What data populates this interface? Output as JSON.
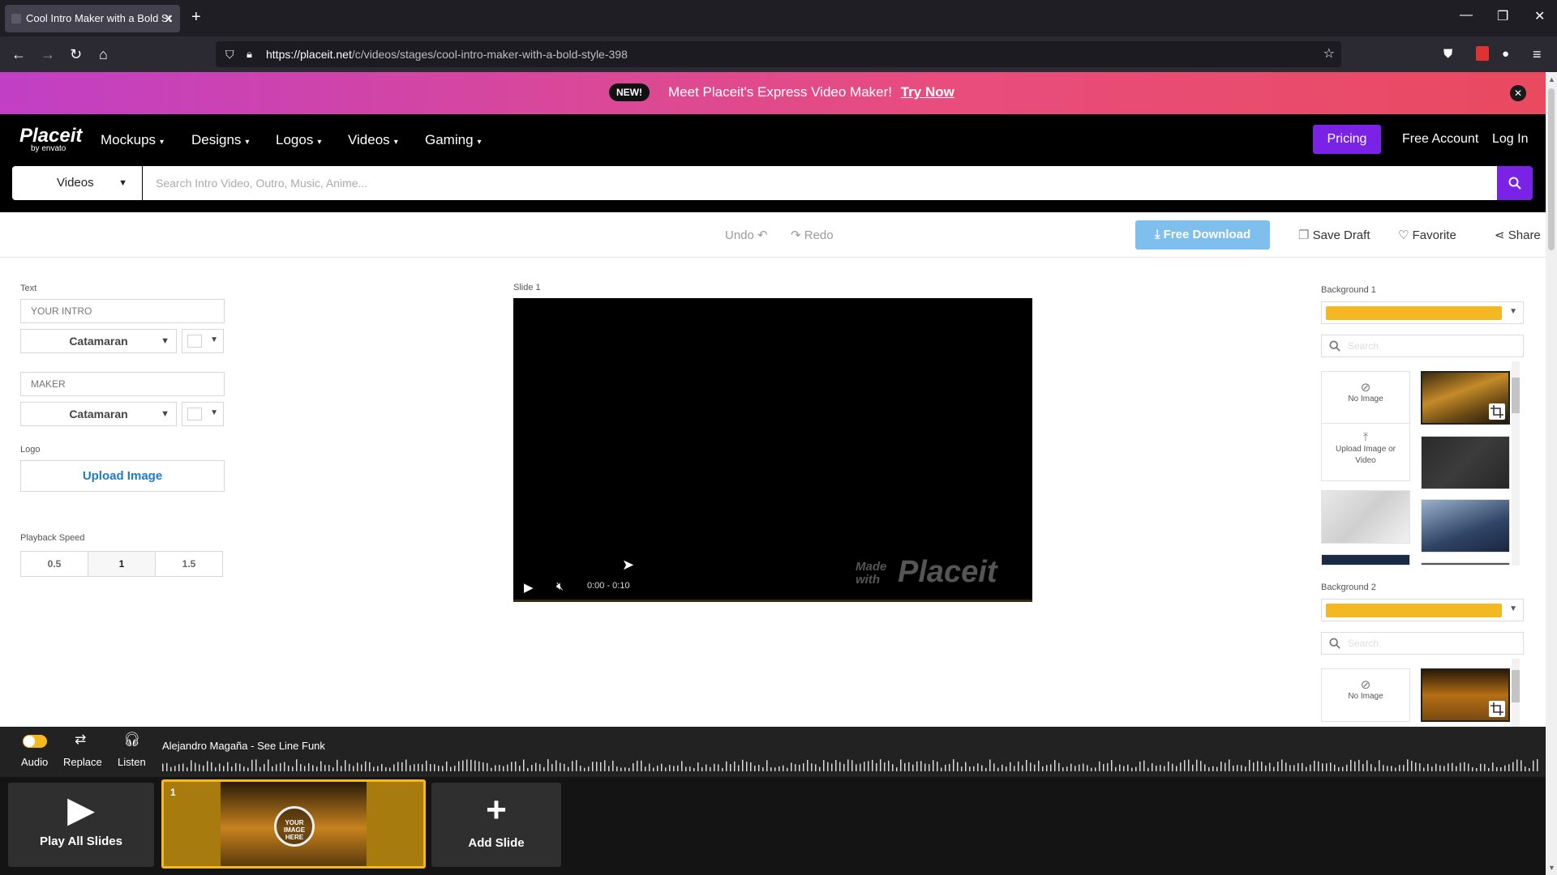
{
  "browser": {
    "tab_title": "Cool Intro Maker with a Bold St",
    "url_domain": "https://placeit.net",
    "url_path": "/c/videos/stages/cool-intro-maker-with-a-bold-style-398"
  },
  "promo": {
    "badge": "NEW!",
    "message": "Meet Placeit's Express Video Maker!",
    "cta": "Try Now"
  },
  "site_nav": {
    "logo_main": "Placeit",
    "logo_sub": "by envato",
    "menu": [
      "Mockups",
      "Designs",
      "Logos",
      "Videos",
      "Gaming"
    ],
    "pricing": "Pricing",
    "free_account": "Free Account",
    "login": "Log In"
  },
  "search": {
    "category": "Videos",
    "placeholder": "Search Intro Video, Outro, Music, Anime..."
  },
  "toolbar": {
    "undo": "Undo",
    "redo": "Redo",
    "free_download": "Free Download",
    "save_draft": "Save Draft",
    "favorite": "Favorite",
    "share": "Share"
  },
  "left_panel": {
    "text_label": "Text",
    "text1_placeholder": "YOUR INTRO",
    "text2_placeholder": "MAKER",
    "font1": "Catamaran",
    "font2": "Catamaran",
    "logo_label": "Logo",
    "upload_image": "Upload Image",
    "playback_label": "Playback Speed",
    "speeds": [
      "0.5",
      "1",
      "1.5"
    ],
    "selected_speed": "1"
  },
  "preview": {
    "slide_label": "Slide 1",
    "time": "0:00 - 0:10",
    "progress": 0.0,
    "watermark_small": "Made with",
    "watermark_big": "Placeit"
  },
  "right_panel": {
    "bg1_label": "Background 1",
    "bg2_label": "Background 2",
    "bg_color": "#f4b822",
    "search_placeholder": "Search",
    "no_image": "No Image",
    "upload_image_video": "Upload Image or Video"
  },
  "audio": {
    "audio_label": "Audio",
    "replace_label": "Replace",
    "listen_label": "Listen",
    "track": "Alejandro Magaña - See Line Funk",
    "enabled": true
  },
  "slides": {
    "play_all": "Play All Slides",
    "slide_number": "1",
    "thumb_text": "YOUR IMAGE HERE",
    "add_slide": "Add Slide"
  },
  "colors": {
    "accent": "#7a22e6",
    "download": "#7fbfee",
    "brand_yellow": "#f4b822"
  }
}
